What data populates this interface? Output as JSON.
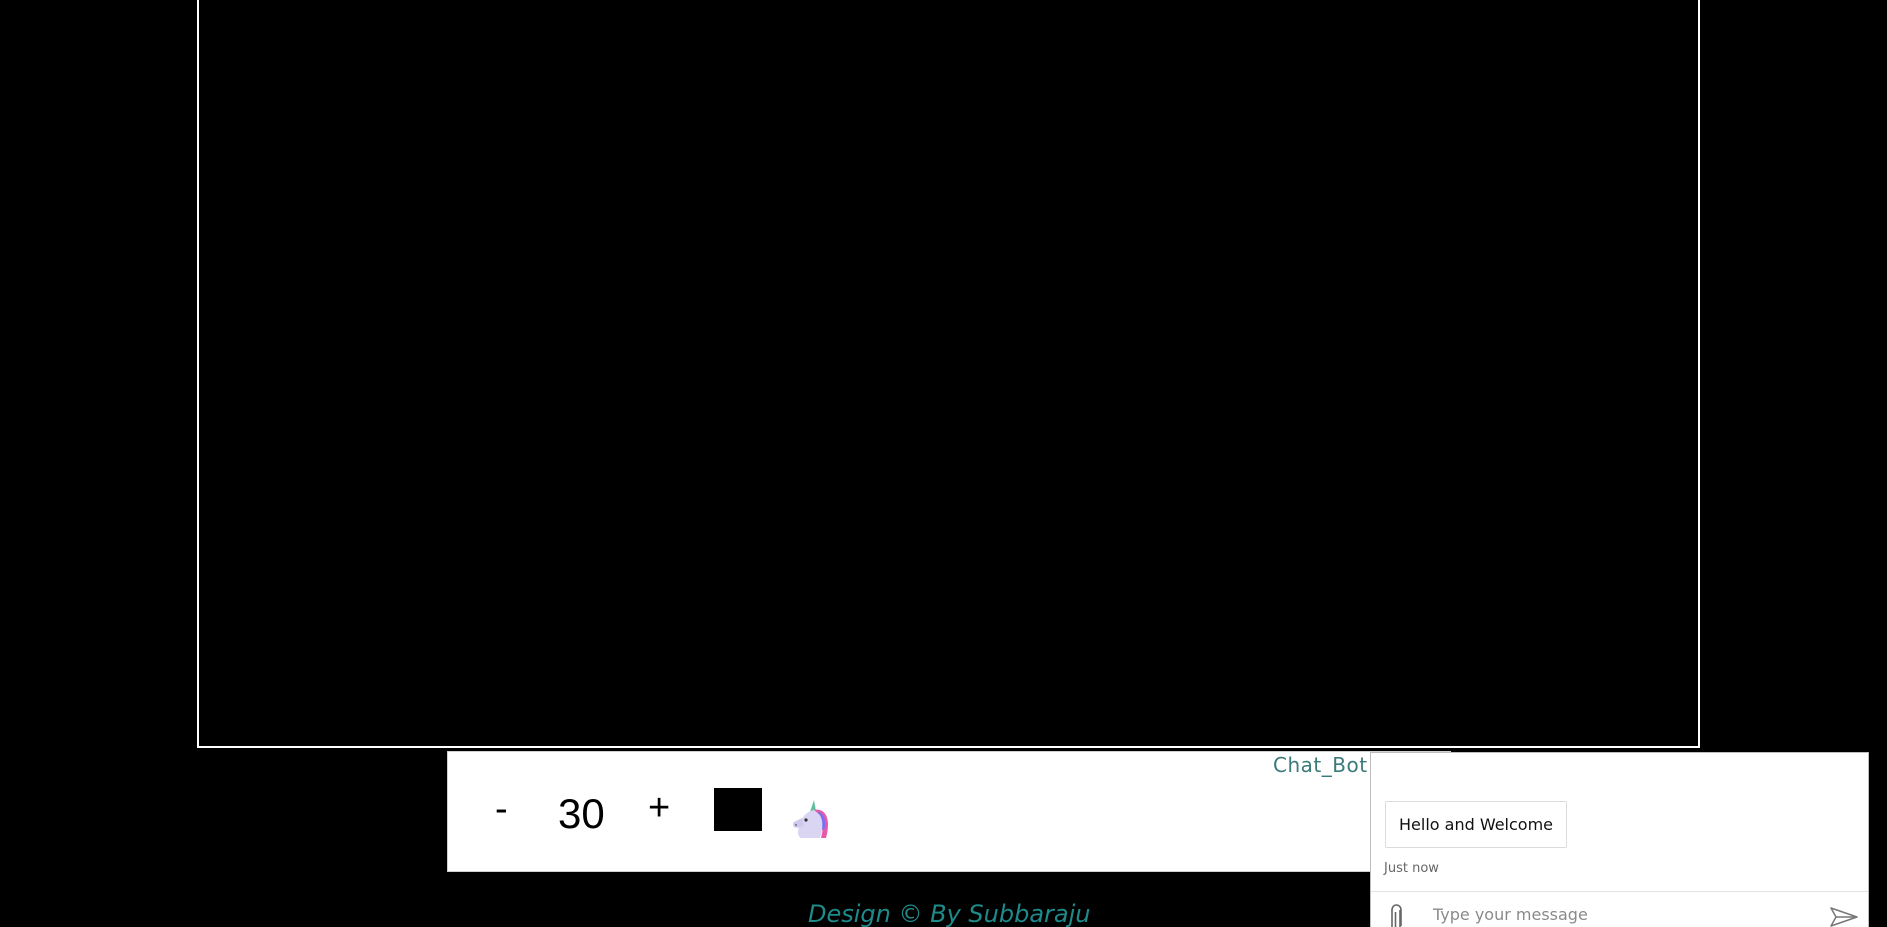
{
  "toolbar": {
    "decrease_label": "-",
    "brush_size": "30",
    "increase_label": "+",
    "selected_color": "#000000",
    "special_tool_icon": "unicorn-icon"
  },
  "chatbot": {
    "label": "Chat_Bot",
    "messages": [
      {
        "text": "Hello and Welcome",
        "time": "Just now"
      }
    ],
    "input_placeholder": "Type your message",
    "attach_icon": "paperclip-icon",
    "send_icon": "send-icon"
  },
  "footer": {
    "credit": "Design © By Subbaraju"
  },
  "colors": {
    "background": "#000000",
    "canvas_border": "#ffffff",
    "accent_teal": "#1e8a8a",
    "chatbot_label": "#3c7a7a"
  }
}
